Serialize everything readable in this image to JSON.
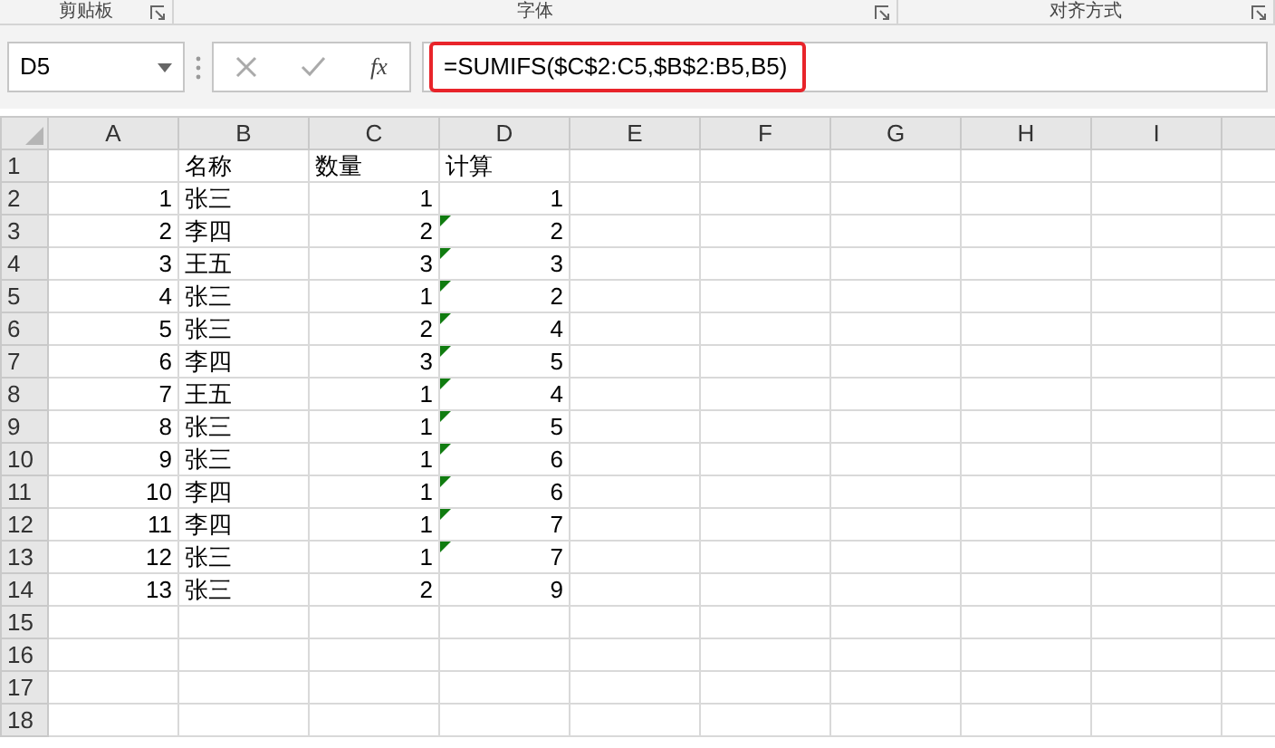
{
  "ribbon_groups": [
    "剪贴板",
    "字体",
    "对齐方式"
  ],
  "formula_bar": {
    "name_box": "D5",
    "function_label": "fx",
    "formula": "=SUMIFS($C$2:C5,$B$2:B5,B5)",
    "annotated": true
  },
  "sheet": {
    "columns": [
      "A",
      "B",
      "C",
      "D",
      "E",
      "F",
      "G",
      "H",
      "I"
    ],
    "rows": [
      {
        "label": "1",
        "cells": [
          "",
          "名称",
          "数量",
          "计算"
        ],
        "error_flag": false
      },
      {
        "label": "2",
        "cells": [
          "1",
          "张三",
          "1",
          "1"
        ],
        "error_flag": false
      },
      {
        "label": "3",
        "cells": [
          "2",
          "李四",
          "2",
          "2"
        ],
        "error_flag": true
      },
      {
        "label": "4",
        "cells": [
          "3",
          "王五",
          "3",
          "3"
        ],
        "error_flag": true
      },
      {
        "label": "5",
        "cells": [
          "4",
          "张三",
          "1",
          "2"
        ],
        "error_flag": true
      },
      {
        "label": "6",
        "cells": [
          "5",
          "张三",
          "2",
          "4"
        ],
        "error_flag": true
      },
      {
        "label": "7",
        "cells": [
          "6",
          "李四",
          "3",
          "5"
        ],
        "error_flag": true
      },
      {
        "label": "8",
        "cells": [
          "7",
          "王五",
          "1",
          "4"
        ],
        "error_flag": true
      },
      {
        "label": "9",
        "cells": [
          "8",
          "张三",
          "1",
          "5"
        ],
        "error_flag": true
      },
      {
        "label": "10",
        "cells": [
          "9",
          "张三",
          "1",
          "6"
        ],
        "error_flag": true
      },
      {
        "label": "11",
        "cells": [
          "10",
          "李四",
          "1",
          "6"
        ],
        "error_flag": true
      },
      {
        "label": "12",
        "cells": [
          "11",
          "李四",
          "1",
          "7"
        ],
        "error_flag": true
      },
      {
        "label": "13",
        "cells": [
          "12",
          "张三",
          "1",
          "7"
        ],
        "error_flag": true
      },
      {
        "label": "14",
        "cells": [
          "13",
          "张三",
          "2",
          "9"
        ],
        "error_flag": false
      },
      {
        "label": "15",
        "cells": [],
        "error_flag": false
      },
      {
        "label": "16",
        "cells": [],
        "error_flag": false
      },
      {
        "label": "17",
        "cells": [],
        "error_flag": false
      },
      {
        "label": "18",
        "cells": [],
        "error_flag": false
      }
    ]
  }
}
